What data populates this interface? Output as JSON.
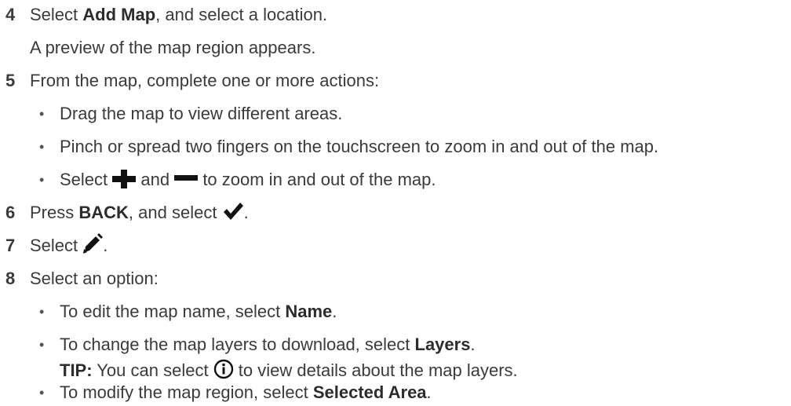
{
  "steps": [
    {
      "number": "4",
      "pre": "Select ",
      "bold": "Add Map",
      "post": ", and select a location.",
      "note": "A preview of the map region appears."
    },
    {
      "number": "5",
      "text": "From the map, complete one or more actions:",
      "bullets": [
        "Drag the map to view different areas.",
        "Pinch or spread two fingers on the touchscreen to zoom in and out of the map."
      ],
      "zoom_bullet": {
        "pre": "Select ",
        "mid": " and ",
        "post": " to zoom in and out of the map.",
        "icons": [
          "plus-icon",
          "minus-icon"
        ]
      }
    },
    {
      "number": "6",
      "pre": "Press ",
      "bold": "BACK",
      "post": ", and select ",
      "end": ".",
      "icon": "checkmark-icon"
    },
    {
      "number": "7",
      "pre": "Select ",
      "end": ".",
      "icon": "pencil-icon"
    },
    {
      "number": "8",
      "text": "Select an option:",
      "options": [
        {
          "pre": "To edit the map name, select ",
          "bold": "Name",
          "post": "."
        },
        {
          "pre": "To change the map layers to download, select ",
          "bold": "Layers",
          "post": "."
        },
        {
          "pre": "To modify the map region, select ",
          "bold": "Selected Area",
          "post": "."
        }
      ],
      "tip": {
        "label": "TIP:",
        "pre": " You can select ",
        "post": " to view details about the map layers.",
        "icon": "info-icon"
      }
    }
  ],
  "bullet_char": "•"
}
